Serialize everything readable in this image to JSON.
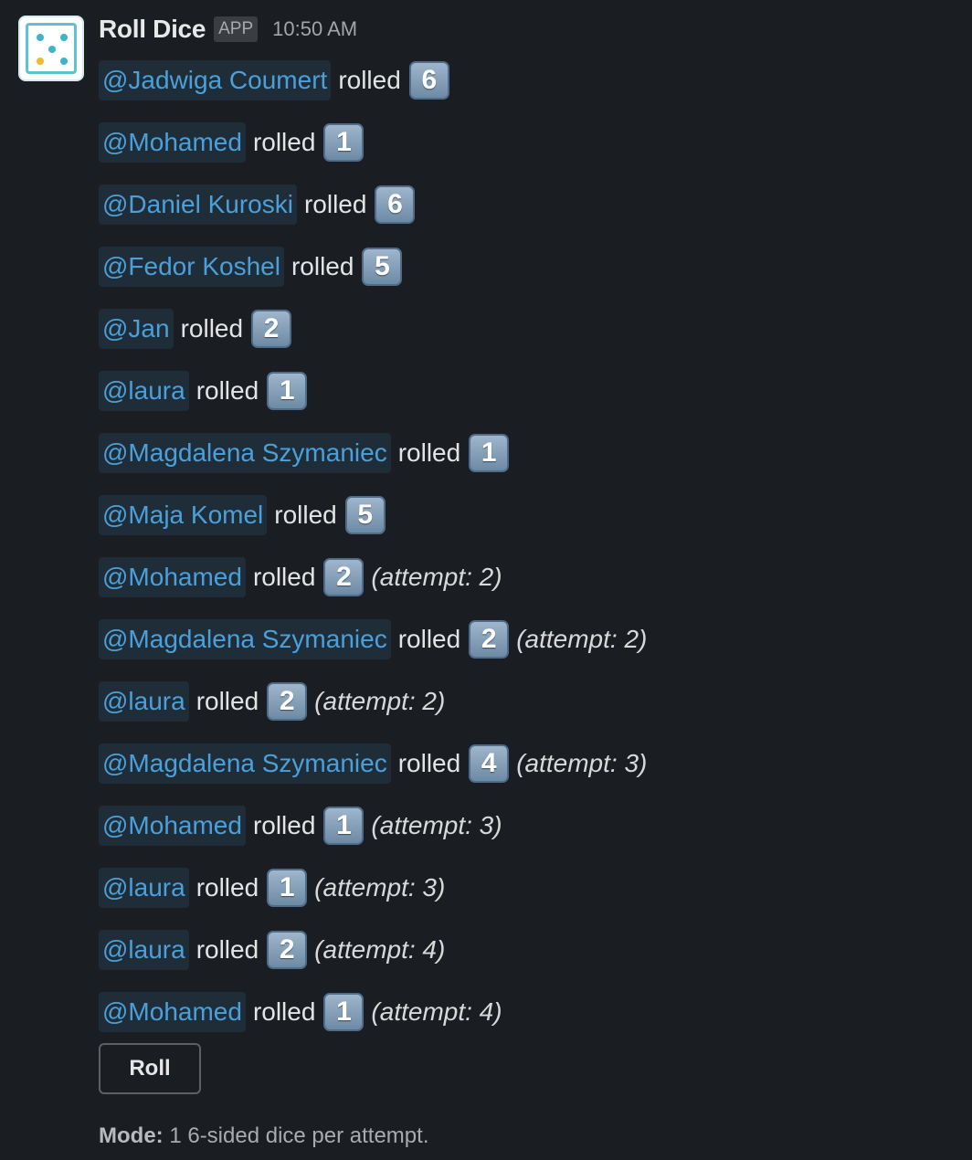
{
  "message": {
    "app_name": "Roll Dice",
    "badge": "APP",
    "timestamp": "10:50 AM",
    "avatar_icon": "dice-five-icon",
    "rolls": [
      {
        "user": "@Jadwiga Coumert",
        "verb": "rolled",
        "value": "6",
        "attempt": ""
      },
      {
        "user": "@Mohamed",
        "verb": "rolled",
        "value": "1",
        "attempt": ""
      },
      {
        "user": "@Daniel Kuroski",
        "verb": "rolled",
        "value": "6",
        "attempt": ""
      },
      {
        "user": "@Fedor Koshel",
        "verb": "rolled",
        "value": "5",
        "attempt": ""
      },
      {
        "user": "@Jan",
        "verb": "rolled",
        "value": "2",
        "attempt": ""
      },
      {
        "user": "@laura",
        "verb": "rolled",
        "value": "1",
        "attempt": ""
      },
      {
        "user": "@Magdalena Szymaniec",
        "verb": "rolled",
        "value": "1",
        "attempt": ""
      },
      {
        "user": "@Maja Komel",
        "verb": "rolled",
        "value": "5",
        "attempt": ""
      },
      {
        "user": "@Mohamed",
        "verb": "rolled",
        "value": "2",
        "attempt": "(attempt: 2)"
      },
      {
        "user": "@Magdalena Szymaniec",
        "verb": "rolled",
        "value": "2",
        "attempt": "(attempt: 2)"
      },
      {
        "user": "@laura",
        "verb": "rolled",
        "value": "2",
        "attempt": "(attempt: 2)"
      },
      {
        "user": "@Magdalena Szymaniec",
        "verb": "rolled",
        "value": "4",
        "attempt": "(attempt: 3)"
      },
      {
        "user": "@Mohamed",
        "verb": "rolled",
        "value": "1",
        "attempt": "(attempt: 3)"
      },
      {
        "user": "@laura",
        "verb": "rolled",
        "value": "1",
        "attempt": "(attempt: 3)"
      },
      {
        "user": "@laura",
        "verb": "rolled",
        "value": "2",
        "attempt": "(attempt: 4)"
      },
      {
        "user": "@Mohamed",
        "verb": "rolled",
        "value": "1",
        "attempt": "(attempt: 4)"
      }
    ],
    "roll_button_label": "Roll",
    "mode_label": "Mode:",
    "mode_text": "1 6-sided dice per attempt."
  },
  "colors": {
    "background": "#1a1d21",
    "mention_text": "#4ba0d9",
    "mention_bg": "#1f2d38",
    "die_face": "#8aa3bc",
    "avatar_pip": "#3fb4c9",
    "avatar_pip_accent": "#f2b830"
  }
}
